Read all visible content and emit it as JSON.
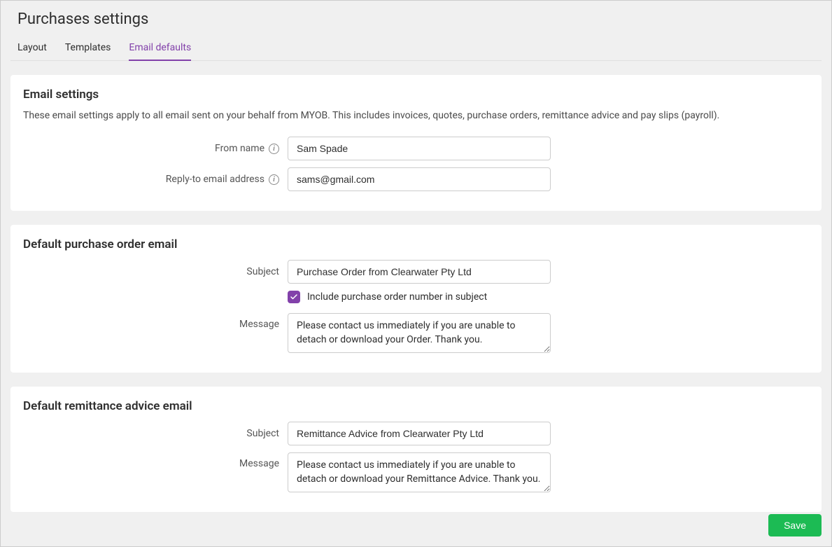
{
  "page": {
    "title": "Purchases settings"
  },
  "tabs": {
    "layout": "Layout",
    "templates": "Templates",
    "email_defaults": "Email defaults"
  },
  "email_settings": {
    "title": "Email settings",
    "description": "These email settings apply to all email sent on your behalf from MYOB. This includes invoices, quotes, purchase orders, remittance advice and pay slips (payroll).",
    "from_name_label": "From name",
    "from_name_value": "Sam Spade",
    "reply_to_label": "Reply-to email address",
    "reply_to_value": "sams@gmail.com"
  },
  "purchase_order": {
    "title": "Default purchase order email",
    "subject_label": "Subject",
    "subject_value": "Purchase Order from Clearwater Pty Ltd",
    "include_number_label": "Include purchase order number in subject",
    "include_number_checked": true,
    "message_label": "Message",
    "message_value": "Please contact us immediately if you are unable to detach or download your Order. Thank you."
  },
  "remittance": {
    "title": "Default remittance advice email",
    "subject_label": "Subject",
    "subject_value": "Remittance Advice from Clearwater Pty Ltd",
    "message_label": "Message",
    "message_value": "Please contact us immediately if you are unable to detach or download your Remittance Advice. Thank you."
  },
  "actions": {
    "save": "Save"
  }
}
